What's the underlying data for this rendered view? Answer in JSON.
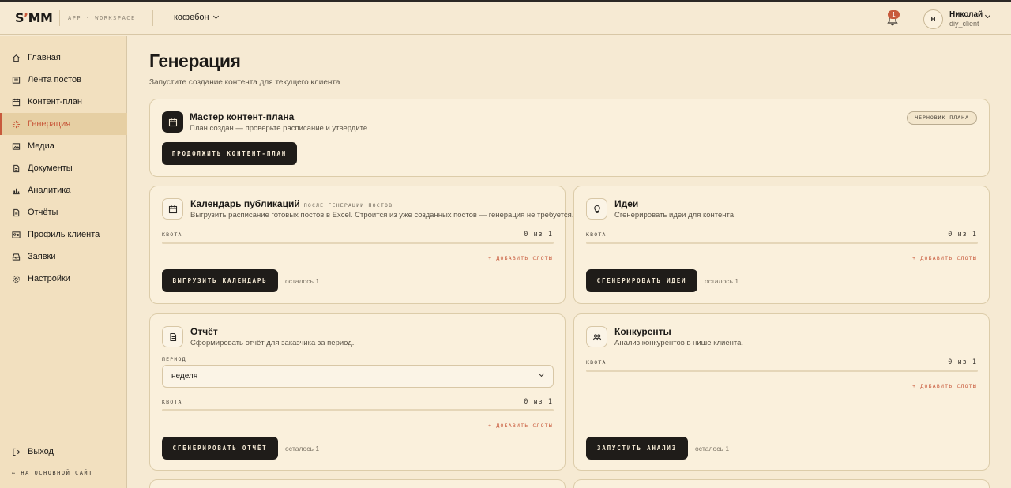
{
  "header": {
    "logo": "S’MM",
    "workspace_label": "APP · WORKSPACE",
    "client": "кофебон",
    "notifications_count": "1",
    "user": {
      "initial": "Н",
      "name": "Николай",
      "role": "diy_client"
    }
  },
  "sidebar": {
    "items": [
      {
        "label": "Главная",
        "icon": "home-icon"
      },
      {
        "label": "Лента постов",
        "icon": "feed-icon"
      },
      {
        "label": "Контент-план",
        "icon": "calendar-icon"
      },
      {
        "label": "Генерация",
        "icon": "sparkle-icon",
        "active": true
      },
      {
        "label": "Медиа",
        "icon": "image-icon"
      },
      {
        "label": "Документы",
        "icon": "document-icon"
      },
      {
        "label": "Аналитика",
        "icon": "chart-icon"
      },
      {
        "label": "Отчёты",
        "icon": "report-icon"
      },
      {
        "label": "Профиль клиента",
        "icon": "profile-card-icon"
      },
      {
        "label": "Заявки",
        "icon": "inbox-icon"
      },
      {
        "label": "Настройки",
        "icon": "gear-icon"
      }
    ],
    "logout": "Выход",
    "main_site": "← НА ОСНОВНОЙ САЙТ"
  },
  "page": {
    "title": "Генерация",
    "subtitle": "Запустите создание контента для текущего клиента"
  },
  "cards": {
    "master": {
      "title": "Мастер контент-плана",
      "desc": "План создан — проверьте расписание и утвердите.",
      "badge": "ЧЕРНОВИК ПЛАНА",
      "button": "ПРОДОЛЖИТЬ КОНТЕНТ-ПЛАН"
    },
    "calendar": {
      "title": "Календарь публикаций",
      "tag": "ПОСЛЕ ГЕНЕРАЦИИ ПОСТОВ",
      "desc": "Выгрузить расписание готовых постов в Excel. Строится из уже созданных постов — генерация не требуется.",
      "quota_label": "КВОТА",
      "quota_value": "0 из 1",
      "quota_fraction": 0,
      "add_slots": "+ ДОБАВИТЬ СЛОТЫ",
      "button": "ВЫГРУЗИТЬ КАЛЕНДАРЬ",
      "remaining": "осталось 1"
    },
    "ideas": {
      "title": "Идеи",
      "desc": "Сгенерировать идеи для контента.",
      "quota_label": "КВОТА",
      "quota_value": "0 из 1",
      "quota_fraction": 0,
      "add_slots": "+ ДОБАВИТЬ СЛОТЫ",
      "button": "СГЕНЕРИРОВАТЬ ИДЕИ",
      "remaining": "осталось 1"
    },
    "report": {
      "title": "Отчёт",
      "desc": "Сформировать отчёт для заказчика за период.",
      "period_label": "ПЕРИОД",
      "period_value": "неделя",
      "quota_label": "КВОТА",
      "quota_value": "0 из 1",
      "quota_fraction": 0,
      "add_slots": "+ ДОБАВИТЬ СЛОТЫ",
      "button": "СГЕНЕРИРОВАТЬ ОТЧЁТ",
      "remaining": "осталось 1"
    },
    "competitors": {
      "title": "Конкуренты",
      "desc": "Анализ конкурентов в нише клиента.",
      "quota_label": "КВОТА",
      "quota_value": "0 из 1",
      "quota_fraction": 0,
      "add_slots": "+ ДОБАВИТЬ СЛОТЫ",
      "button": "ЗАПУСТИТЬ АНАЛИЗ",
      "remaining": "осталось 1"
    }
  },
  "colors": {
    "accent": "#c85a3c",
    "background": "#f6ead3",
    "sidebar": "#f2e0bf",
    "button": "#1f1c19"
  }
}
